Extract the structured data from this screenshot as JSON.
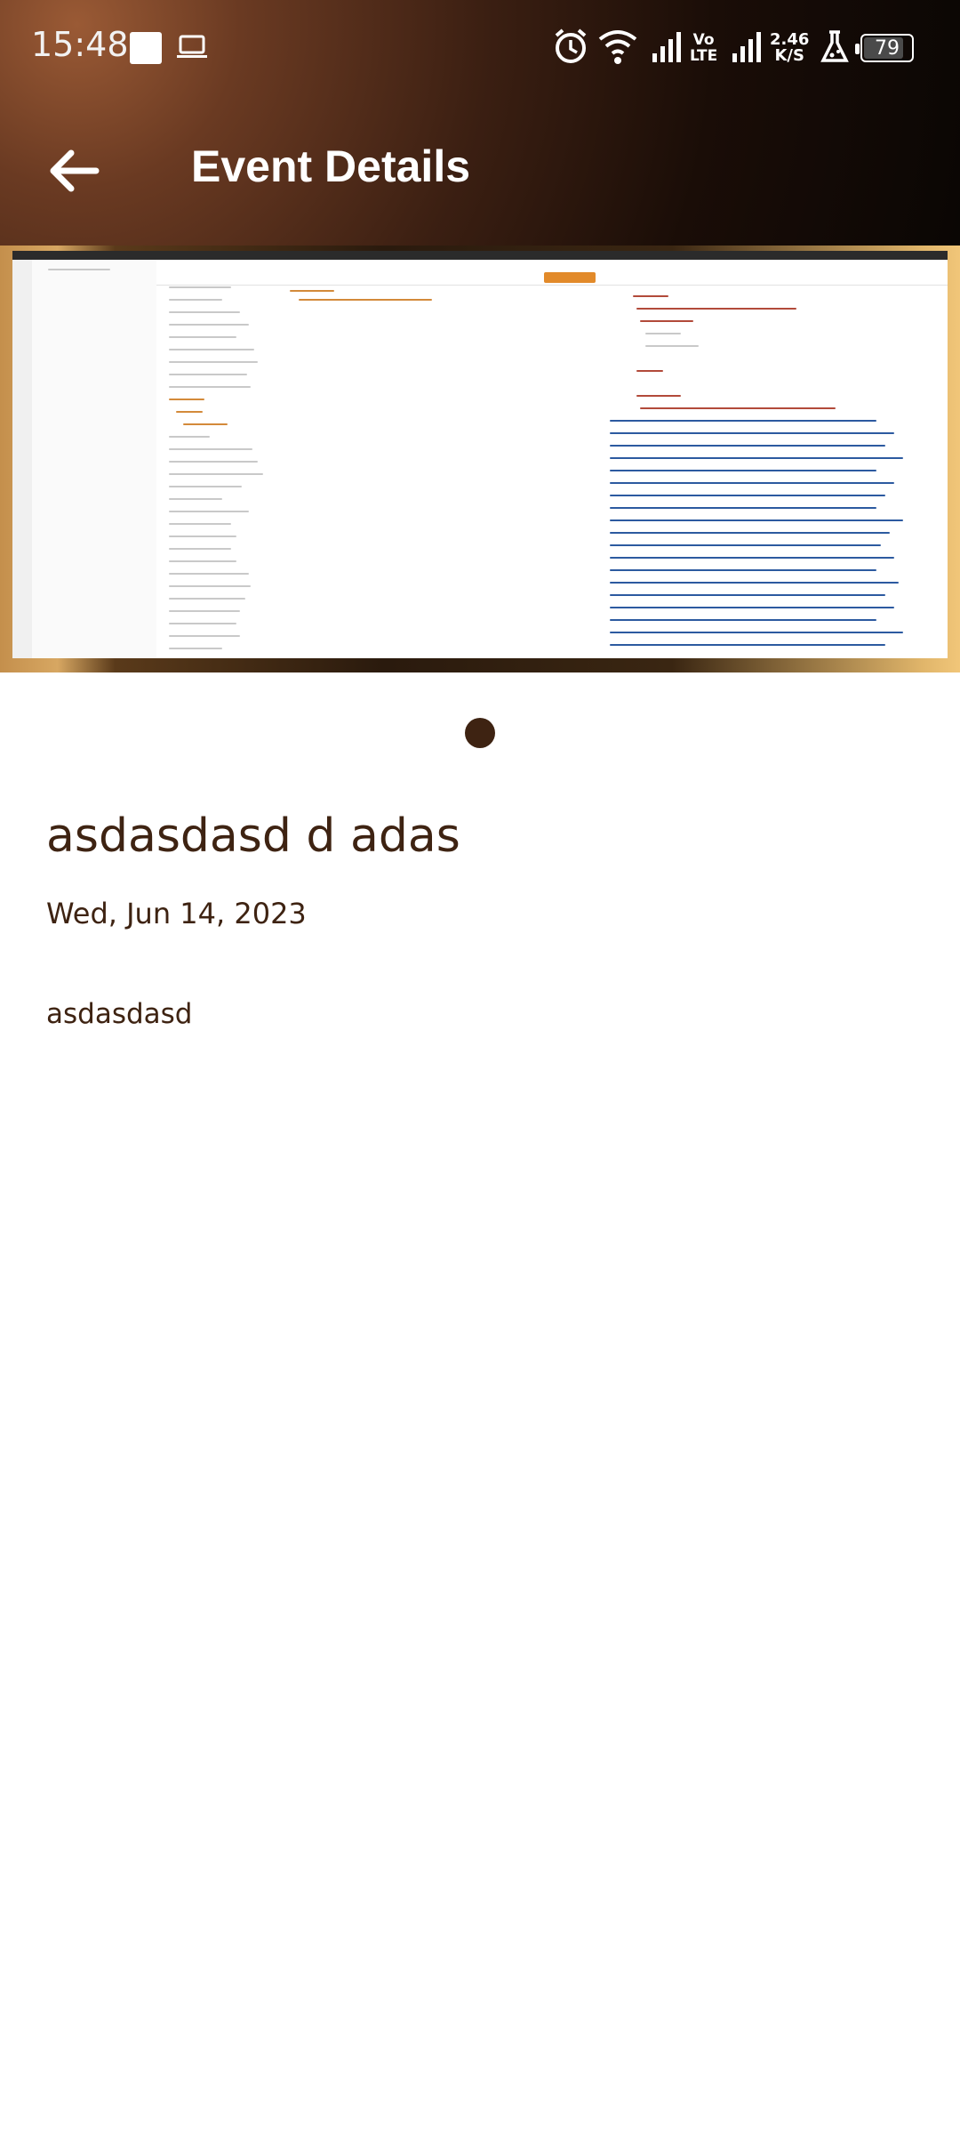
{
  "status_bar": {
    "time": "15:48",
    "volte_top": "Vo",
    "volte_bottom": "LTE",
    "net_speed_value": "2.46",
    "net_speed_unit": "K/S",
    "battery": "79"
  },
  "app_bar": {
    "title": "Event Details",
    "back_icon": "arrow-left-icon"
  },
  "event": {
    "title": "asdasdasd d adas",
    "date": "Wed, Jun 14, 2023",
    "description": "asdasdasd"
  },
  "carousel": {
    "page_count": 1,
    "active_page": 1
  },
  "colors": {
    "text": "#3e2312",
    "accent_dot": "#3e2312"
  }
}
